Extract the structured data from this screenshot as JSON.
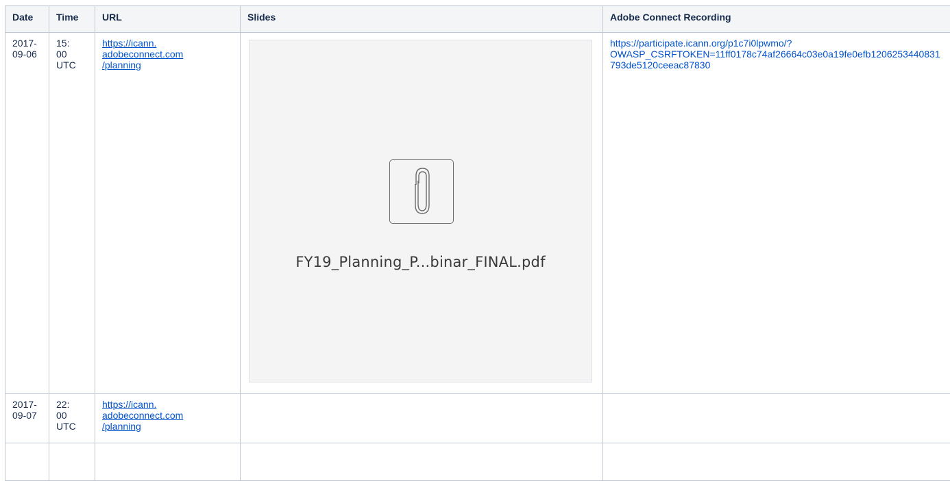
{
  "table": {
    "headers": {
      "date": "Date",
      "time": "Time",
      "url": "URL",
      "slides": "Slides",
      "recording": "Adobe Connect Recording"
    },
    "rows": [
      {
        "date": "2017-09-06",
        "time": "15:00 UTC",
        "url": "https://icann.adobeconnect.com/planning",
        "slides_file": "FY19_Planning_P...binar_FINAL.pdf",
        "slides_icon": "paperclip-icon",
        "recording": "https://participate.icann.org/p1c7i0lpwmo/?OWASP_CSRFTOKEN=11ff0178c74af26664c03e0a19fe0efb1206253440831793de5120ceeac87830"
      },
      {
        "date": "2017-09-07",
        "time": "22:00 UTC",
        "url": "https://icann.adobeconnect.com/planning",
        "slides_file": "",
        "recording": ""
      },
      {
        "date": "",
        "time": "",
        "url": "",
        "slides_file": "",
        "recording": ""
      }
    ]
  },
  "colors": {
    "link": "#0052cc",
    "header_bg": "#f4f5f7",
    "border": "#c1c7d0",
    "preview_bg": "#f4f4f4"
  }
}
